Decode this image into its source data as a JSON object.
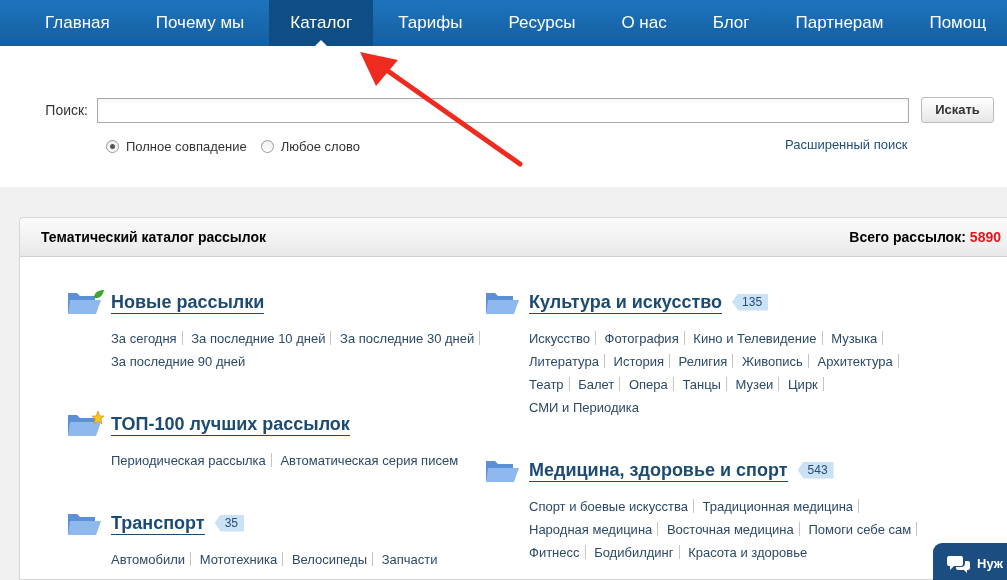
{
  "nav": [
    {
      "label": "Главная",
      "selected": false
    },
    {
      "label": "Почему мы",
      "selected": false
    },
    {
      "label": "Каталог",
      "selected": true
    },
    {
      "label": "Тарифы",
      "selected": false
    },
    {
      "label": "Ресурсы",
      "selected": false
    },
    {
      "label": "О нас",
      "selected": false
    },
    {
      "label": "Блог",
      "selected": false
    },
    {
      "label": "Партнерам",
      "selected": false
    },
    {
      "label": "Помощ",
      "selected": false
    }
  ],
  "search": {
    "label": "Поиск:",
    "button": "Искать",
    "options": [
      {
        "label": "Полное совпадение",
        "selected": true
      },
      {
        "label": "Любое слово",
        "selected": false
      }
    ],
    "advanced_link": "Расширенный поиск"
  },
  "catalog": {
    "title": "Тематический каталог рассылок",
    "total_label": "Всего рассылок:",
    "total_value": "5890",
    "columns": [
      [
        {
          "kind": "new",
          "title": "Новые рассылки",
          "links": [
            "За сегодня",
            "За последние 10 дней",
            "За последние 30 дней",
            "За последние 90 дней"
          ]
        },
        {
          "kind": "top",
          "title": "ТОП-100 лучших рассылок",
          "links": [
            "Периодическая рассылка",
            "Автоматическая серия писем"
          ]
        },
        {
          "kind": "folder",
          "title": "Транспорт",
          "count": "35",
          "links": [
            "Автомобили",
            "Мототехника",
            "Велосипеды",
            "Запчасти"
          ]
        }
      ],
      [
        {
          "kind": "folder",
          "title": "Культура и искусство",
          "count": "135",
          "links": [
            "Искусство",
            "Фотография",
            "Кино и Телевидение",
            "Музыка",
            "Литература",
            "История",
            "Религия",
            "Живопись",
            "Архитектура",
            "Театр",
            "Балет",
            "Опера",
            "Танцы",
            "Музеи",
            "Цирк",
            "СМИ и Периодика"
          ]
        },
        {
          "kind": "folder",
          "title": "Медицина, здоровье и спорт",
          "count": "543",
          "links": [
            "Спорт и боевые искусства",
            "Традиционная медицина",
            "Народная медицина",
            "Восточная медицина",
            "Помоги себе сам",
            "Фитнесс",
            "Бодибилдинг",
            "Красота и здоровье"
          ]
        }
      ]
    ]
  },
  "chat": {
    "label": "Нуж"
  }
}
